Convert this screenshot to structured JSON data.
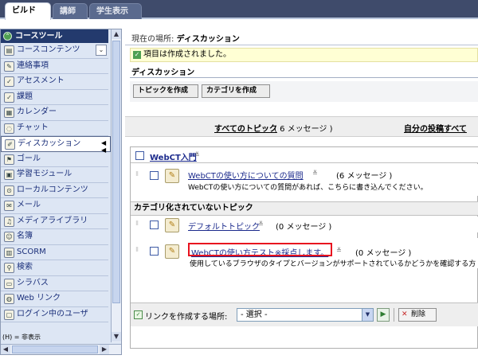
{
  "tabs": [
    {
      "label": "ビルド",
      "active": true
    },
    {
      "label": "講師",
      "active": false
    },
    {
      "label": "学生表示",
      "active": false
    }
  ],
  "sidebar": {
    "header": "コースツール",
    "items": [
      {
        "label": "コースコンテンツ",
        "icon": "content-icon",
        "has_dropdown": true
      },
      {
        "label": "連絡事項",
        "icon": "announcement-icon"
      },
      {
        "label": "アセスメント",
        "icon": "assessment-icon"
      },
      {
        "label": "課題",
        "icon": "assignment-icon"
      },
      {
        "label": "カレンダー",
        "icon": "calendar-icon"
      },
      {
        "label": "チャット",
        "icon": "chat-icon"
      },
      {
        "label": "ディスカッション",
        "icon": "discussion-icon",
        "selected": true
      },
      {
        "label": "ゴール",
        "icon": "goal-icon"
      },
      {
        "label": "学習モジュール",
        "icon": "module-icon"
      },
      {
        "label": "ローカルコンテンツ",
        "icon": "local-content-icon"
      },
      {
        "label": "メール",
        "icon": "mail-icon"
      },
      {
        "label": "メディアライブラリ",
        "icon": "media-library-icon"
      },
      {
        "label": "名簿",
        "icon": "roster-icon"
      },
      {
        "label": "SCORM",
        "icon": "scorm-icon"
      },
      {
        "label": "検索",
        "icon": "search-icon"
      },
      {
        "label": "シラバス",
        "icon": "syllabus-icon"
      },
      {
        "label": "Web リンク",
        "icon": "web-link-icon"
      },
      {
        "label": "ログイン中のユーザ",
        "icon": "online-users-icon"
      }
    ],
    "legend": "(H) = 非表示"
  },
  "main": {
    "location_prefix": "現在の場所: ",
    "location": "ディスカッション",
    "notice": "項目は作成されました。",
    "page_title": "ディスカッション",
    "buttons": {
      "create_topic": "トピックを作成",
      "create_category": "カテゴリを作成"
    },
    "views": {
      "all_topics": "すべてのトピック",
      "all_topics_count": "( 6 メッセージ )",
      "my_posts": "自分の投稿すべて"
    },
    "category1": {
      "name": "WebCT入門",
      "topic": {
        "title": "WebCTの使い方についての質問",
        "count": "(6 メッセージ )",
        "description": "WebCTの使い方についての質問があれば、こちらに書き込んでください。"
      }
    },
    "category2": {
      "name": "カテゴリ化されていないトピック",
      "topics": [
        {
          "title": "デフォルトトピック",
          "count": "(0 メッセージ )"
        },
        {
          "title": "WebCTの使い方テスト※採点します。",
          "count": "(0 メッセージ )",
          "description": "使用しているブラウザのタイプとバージョンがサポートされているかどうかを確認する方",
          "highlighted": true
        }
      ]
    },
    "bottom": {
      "link_label": "リンクを作成する場所:",
      "select_value": "- 選択 -",
      "delete_label": "削除"
    }
  },
  "colors": {
    "topbar": "#3f4b6b",
    "sidebar_header": "#233a6d",
    "sidebar_bg": "#dde6f4",
    "link": "#1b2a8c",
    "highlight": "#e8121f",
    "notice_bg": "#ffffd4"
  }
}
